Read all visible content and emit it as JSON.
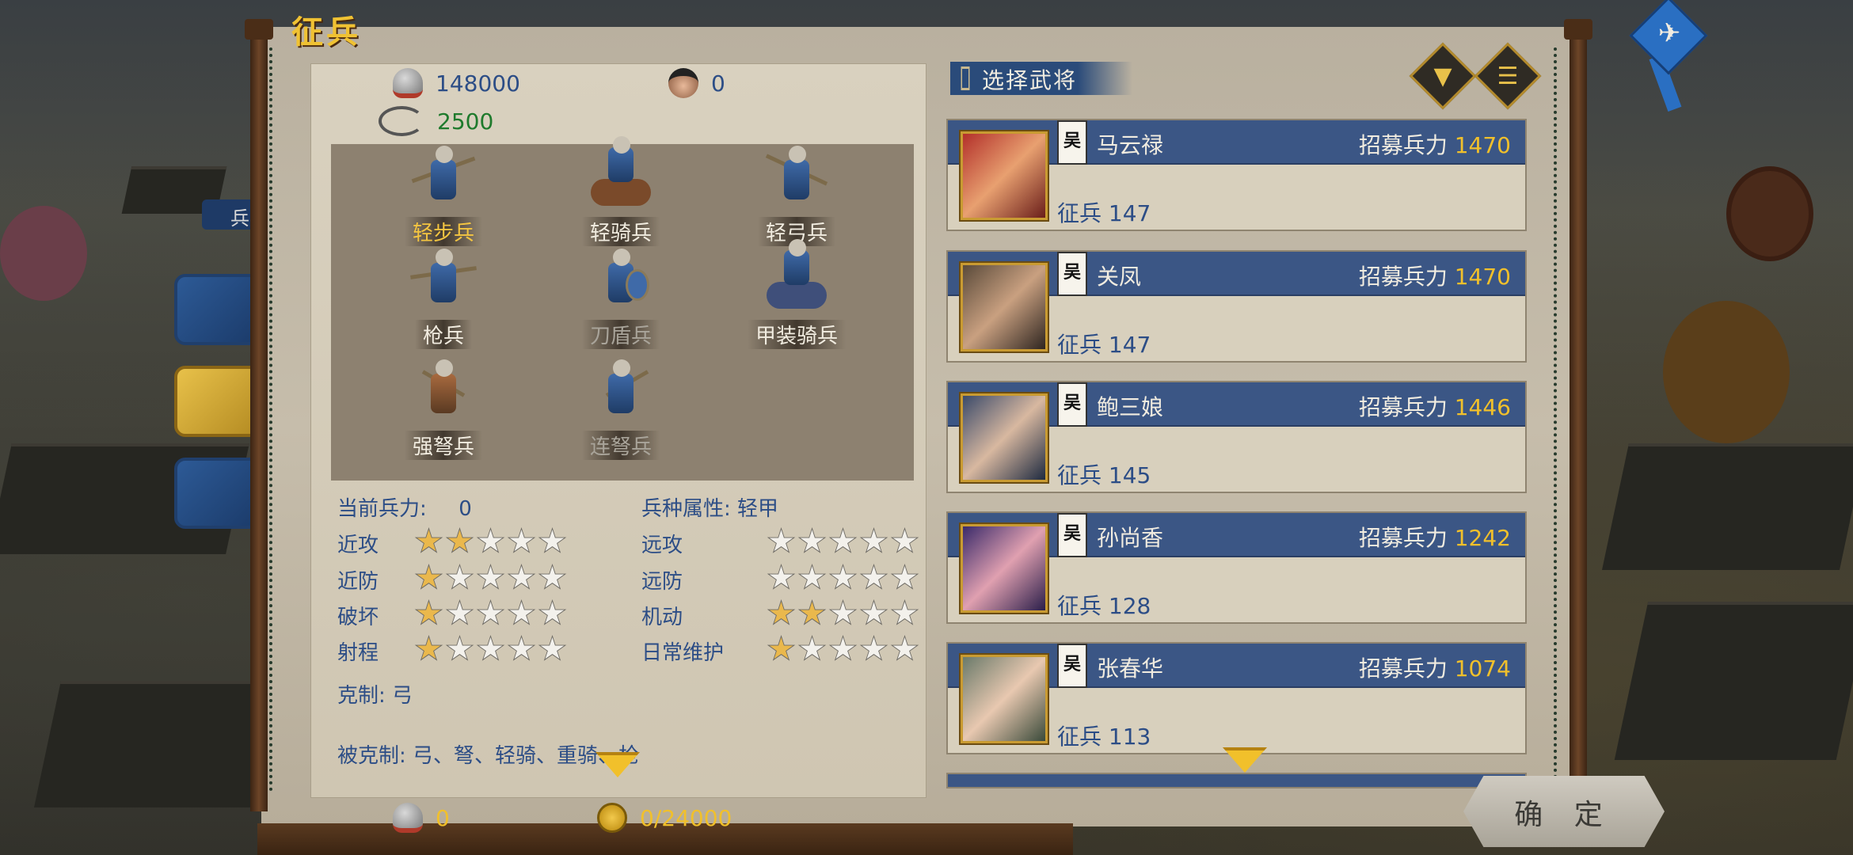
{
  "window": {
    "title": "征兵"
  },
  "side_tab": {
    "label": "兵"
  },
  "resources": {
    "soldiers_total": "148000",
    "generals_count": "0",
    "conversion_value": "2500",
    "bottom_soldiers": "0",
    "bottom_capacity": "0/24000"
  },
  "troops": [
    {
      "label": "轻步兵",
      "state": "selected"
    },
    {
      "label": "轻骑兵",
      "state": "normal"
    },
    {
      "label": "轻弓兵",
      "state": "normal"
    },
    {
      "label": "枪兵",
      "state": "normal"
    },
    {
      "label": "刀盾兵",
      "state": "dim"
    },
    {
      "label": "甲装骑兵",
      "state": "normal"
    },
    {
      "label": "强弩兵",
      "state": "normal"
    },
    {
      "label": "连弩兵",
      "state": "dim"
    }
  ],
  "stats": {
    "current_force_label": "当前兵力:",
    "current_force_value": "0",
    "attribute_label": "兵种属性:",
    "attribute_value": "轻甲",
    "rows": [
      {
        "label": "近攻",
        "stars": 2
      },
      {
        "label": "近防",
        "stars": 1
      },
      {
        "label": "破坏",
        "stars": 1
      },
      {
        "label": "射程",
        "stars": 1
      }
    ],
    "rows_right": [
      {
        "label": "远攻",
        "stars": 0
      },
      {
        "label": "远防",
        "stars": 0
      },
      {
        "label": "机动",
        "stars": 2
      },
      {
        "label": "日常维护",
        "stars": 1
      }
    ],
    "counters_label": "克制:",
    "counters_value": "弓",
    "countered_by_label": "被克制:",
    "countered_by_value": "弓、弩、轻骑、重骑、枪"
  },
  "select_general": {
    "title": "选择武将",
    "filter_icon": "filter-icon",
    "list_icon": "list-icon"
  },
  "generals": [
    {
      "faction": "吴",
      "name": "马云禄",
      "recruit_label": "招募兵力",
      "recruit_value": "1470",
      "draft_label": "征兵",
      "draft_value": "147"
    },
    {
      "faction": "吴",
      "name": "关凤",
      "recruit_label": "招募兵力",
      "recruit_value": "1470",
      "draft_label": "征兵",
      "draft_value": "147"
    },
    {
      "faction": "吴",
      "name": "鲍三娘",
      "recruit_label": "招募兵力",
      "recruit_value": "1446",
      "draft_label": "征兵",
      "draft_value": "145"
    },
    {
      "faction": "吴",
      "name": "孙尚香",
      "recruit_label": "招募兵力",
      "recruit_value": "1242",
      "draft_label": "征兵",
      "draft_value": "128"
    },
    {
      "faction": "吴",
      "name": "张春华",
      "recruit_label": "招募兵力",
      "recruit_value": "1074",
      "draft_label": "征兵",
      "draft_value": "113"
    }
  ],
  "confirm_button": {
    "label": "确 定"
  },
  "colors": {
    "accent": "#f1c02b",
    "card_header": "#3b5685",
    "text_blue": "#2c4d86"
  }
}
